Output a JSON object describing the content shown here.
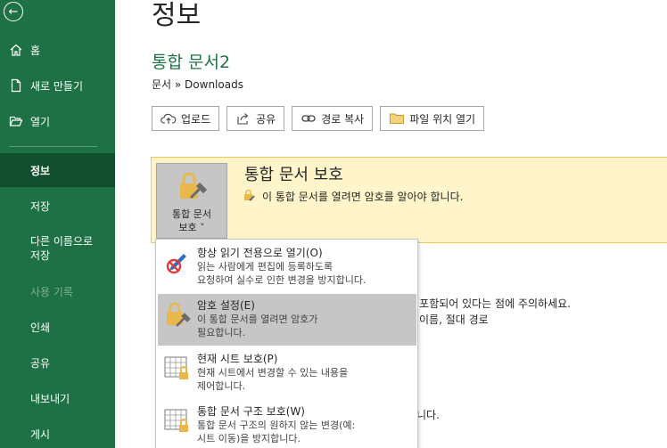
{
  "sidebar": {
    "back_icon": "back-arrow-icon",
    "items": [
      {
        "label": "홈",
        "icon": "home-icon"
      },
      {
        "label": "새로 만들기",
        "icon": "new-document-icon"
      },
      {
        "label": "열기",
        "icon": "open-folder-icon"
      },
      {
        "label": "정보"
      },
      {
        "label": "저장"
      },
      {
        "label": "다른 이름으로 저장"
      },
      {
        "label": "사용 기록"
      },
      {
        "label": "인쇄"
      },
      {
        "label": "공유"
      },
      {
        "label": "내보내기"
      },
      {
        "label": "게시"
      }
    ]
  },
  "page": {
    "title": "정보",
    "doc_title": "통합 문서2",
    "breadcrumb": "문서 » Downloads"
  },
  "toolbar": {
    "buttons": [
      {
        "label": "업로드",
        "icon": "cloud-upload-icon"
      },
      {
        "label": "공유",
        "icon": "share-icon"
      },
      {
        "label": "경로 복사",
        "icon": "link-icon"
      },
      {
        "label": "파일 위치 열기",
        "icon": "folder-icon"
      }
    ]
  },
  "protect": {
    "tile_label_1": "통합 문서",
    "tile_label_2": "보호 ˅",
    "heading": "통합 문서 보호",
    "description": "이 통합 문서를 열려면 암호를 알아야 합니다."
  },
  "background": {
    "line1": "l 포함되어 있다는 점에 주의하세요.",
    "line2": "이름, 절대 경로",
    "line3": "니다."
  },
  "menu": {
    "items": [
      {
        "title": "항상 읽기 전용으로 열기(O)",
        "desc1": "읽는 사람에게 편집에 등록하도록",
        "desc2": "요청하여 실수로 인한 변경을 방지합니다."
      },
      {
        "title": "암호 설정(E)",
        "desc1": "이 통합 문서를 열려면 암호가",
        "desc2": "필요합니다."
      },
      {
        "title": "현재 시트 보호(P)",
        "desc1": "현재 시트에서 변경할 수 있는 내용을",
        "desc2": "제어합니다."
      },
      {
        "title": "통합 문서 구조 보호(W)",
        "desc1": "통합 문서 구조의 원하지 않는 변경(예:",
        "desc2": "시트 이동)을 방지합니다."
      }
    ]
  },
  "colors": {
    "sidebar_bg": "#1e7145",
    "sidebar_active": "#104e2d",
    "accent_green": "#217346",
    "protect_bg": "#fff4ca",
    "lock_gold": "#e8b84a"
  }
}
